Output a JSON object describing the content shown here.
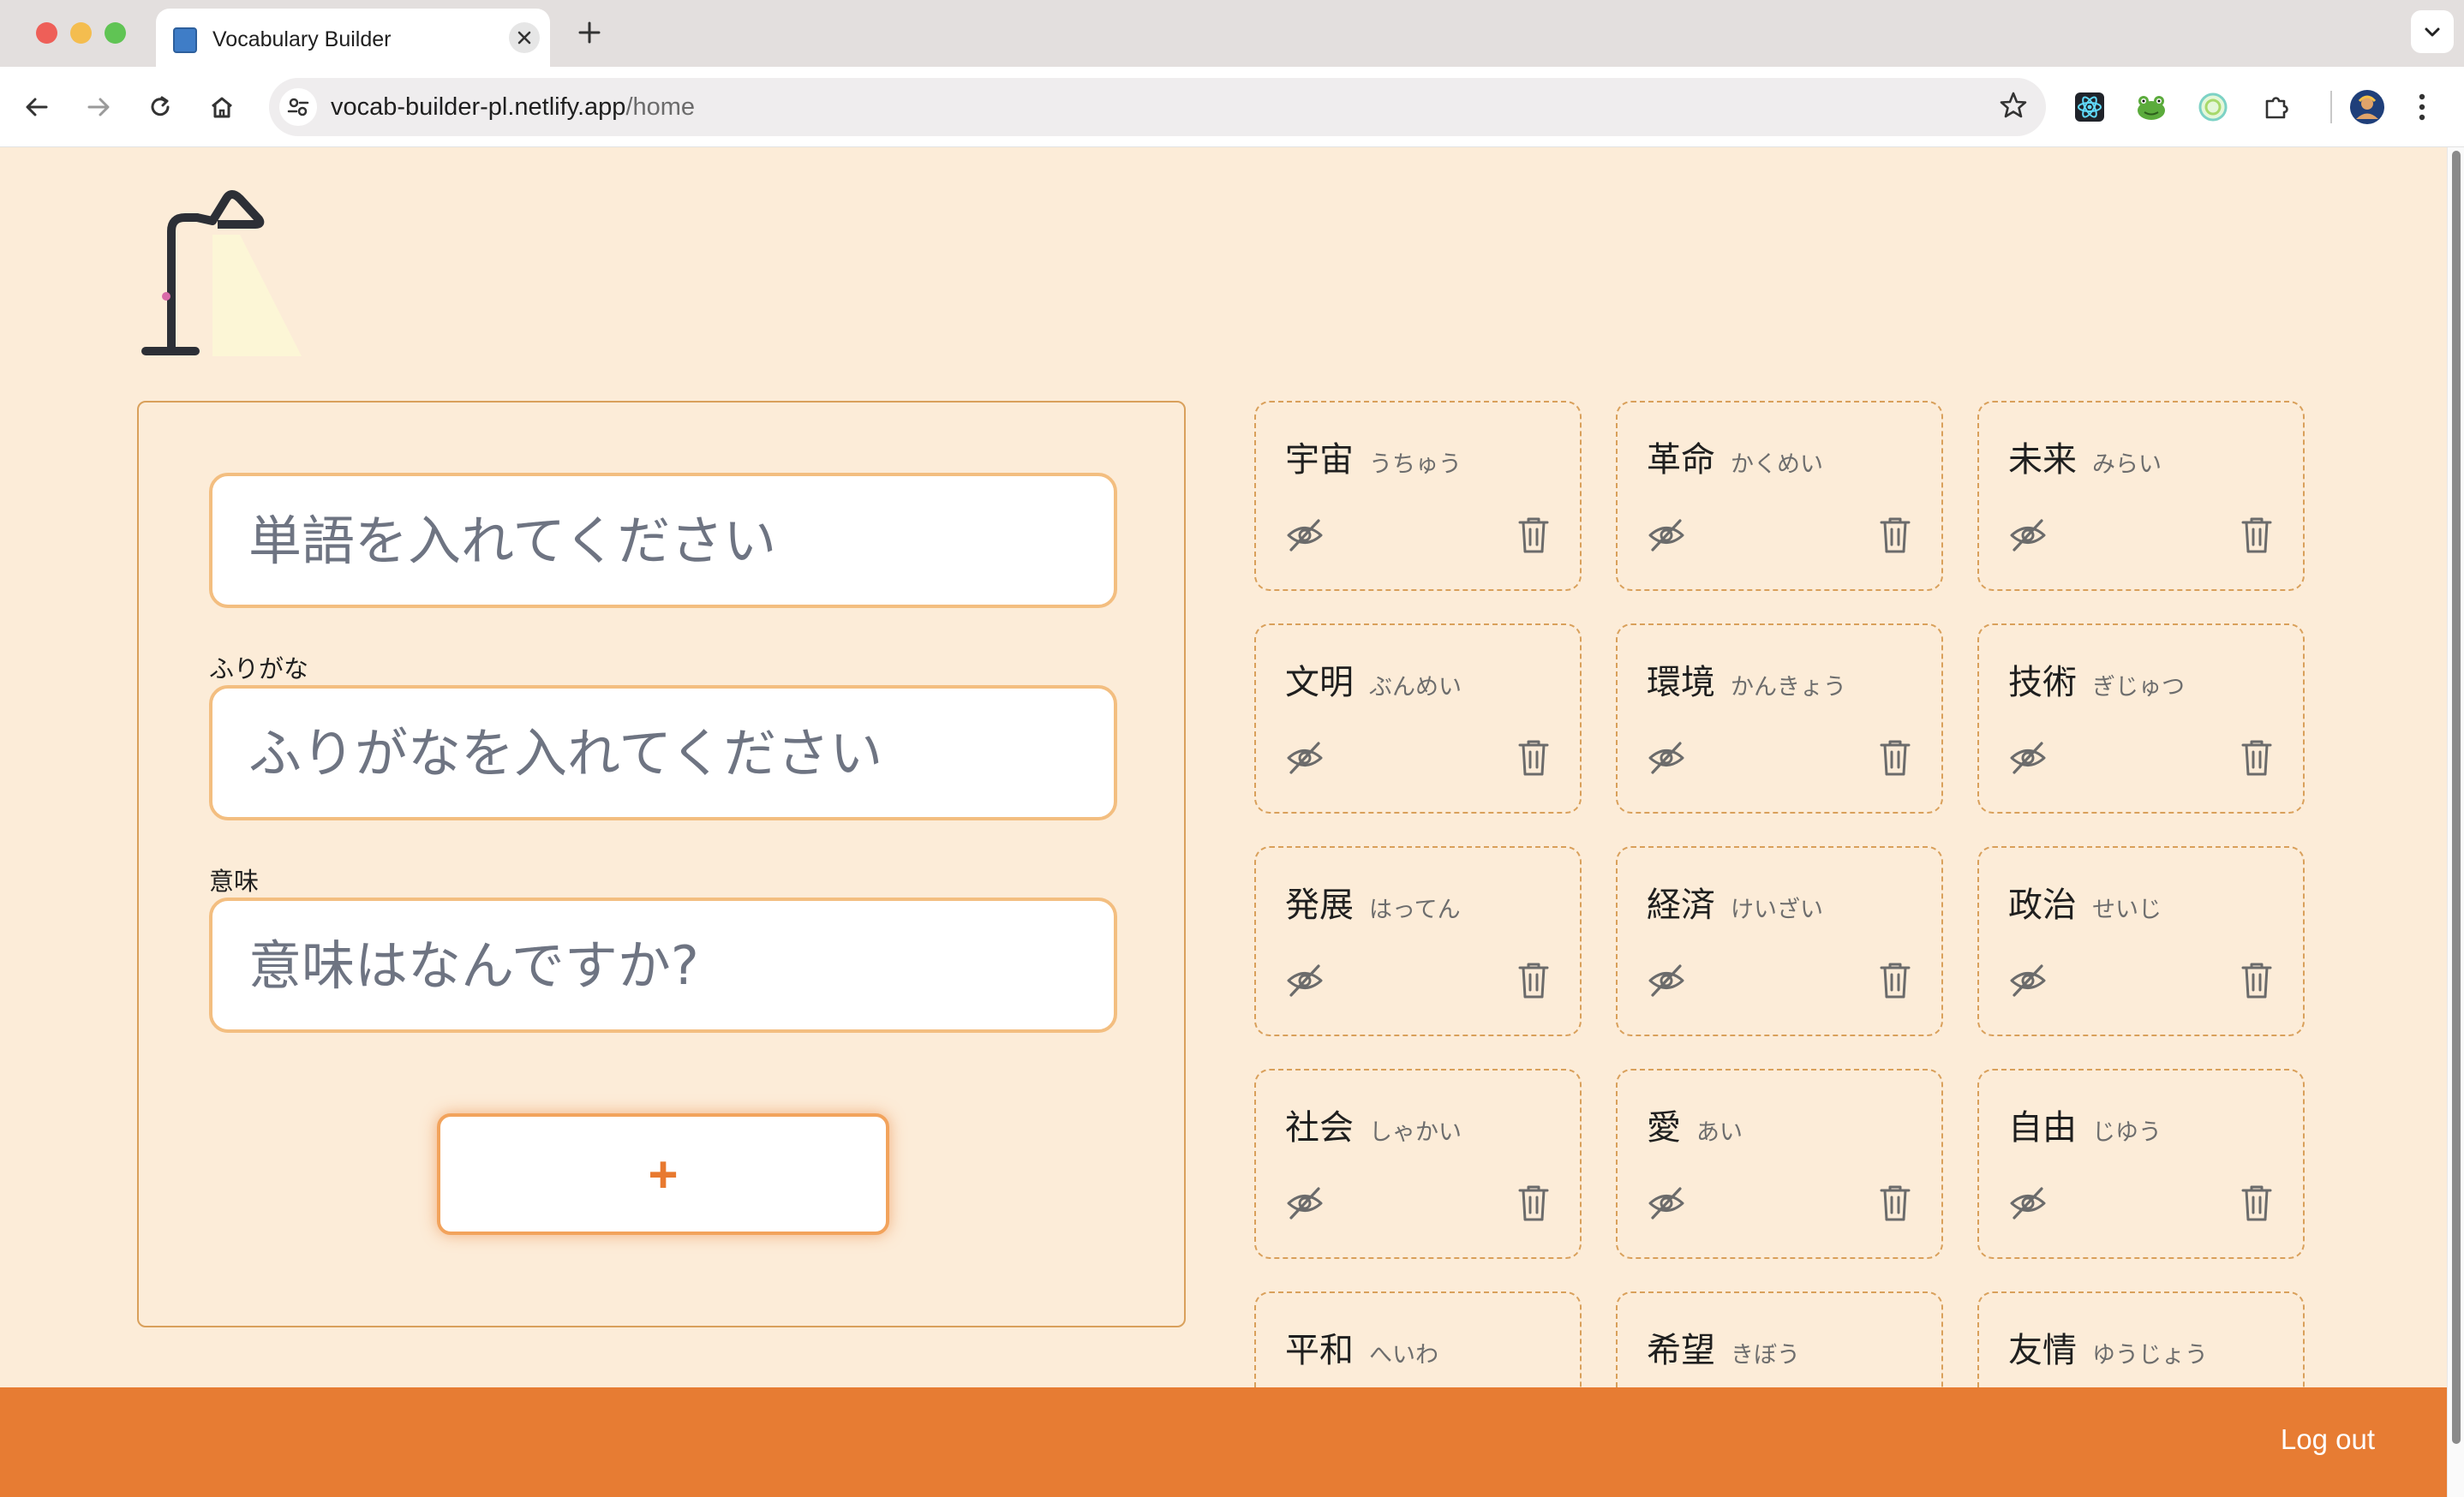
{
  "browser": {
    "tab_title": "Vocabulary Builder",
    "url_host": "vocab-builder-pl.netlify.app",
    "url_path": "/home"
  },
  "form": {
    "word_placeholder": "単語を入れてください",
    "reading_label": "ふりがな",
    "reading_placeholder": "ふりがなを入れてください",
    "meaning_label": "意味",
    "meaning_placeholder": "意味はなんですか?",
    "add_label": "+"
  },
  "words": [
    {
      "word": "宇宙",
      "reading": "うちゅう"
    },
    {
      "word": "革命",
      "reading": "かくめい"
    },
    {
      "word": "未来",
      "reading": "みらい"
    },
    {
      "word": "文明",
      "reading": "ぶんめい"
    },
    {
      "word": "環境",
      "reading": "かんきょう"
    },
    {
      "word": "技術",
      "reading": "ぎじゅつ"
    },
    {
      "word": "発展",
      "reading": "はってん"
    },
    {
      "word": "経済",
      "reading": "けいざい"
    },
    {
      "word": "政治",
      "reading": "せいじ"
    },
    {
      "word": "社会",
      "reading": "しゃかい"
    },
    {
      "word": "愛",
      "reading": "あい"
    },
    {
      "word": "自由",
      "reading": "じゆう"
    },
    {
      "word": "平和",
      "reading": "へいわ"
    },
    {
      "word": "希望",
      "reading": "きぼう"
    },
    {
      "word": "友情",
      "reading": "ゆうじょう"
    }
  ],
  "footer": {
    "logout_label": "Log out"
  },
  "colors": {
    "background": "#fcecd8",
    "accent": "#e77c33",
    "border": "#d9a05b"
  }
}
